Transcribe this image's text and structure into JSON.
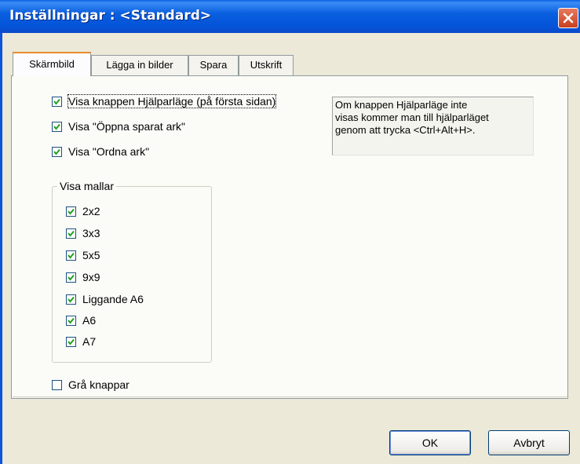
{
  "window": {
    "title": "Inställningar : <Standard>"
  },
  "tabs": [
    {
      "label": "Skärmbild",
      "active": true
    },
    {
      "label": "Lägga in bilder",
      "active": false
    },
    {
      "label": "Spara",
      "active": false
    },
    {
      "label": "Utskrift",
      "active": false
    }
  ],
  "options": {
    "show_help_mode": {
      "label": "Visa knappen Hjälparläge (på första sidan)",
      "checked": true
    },
    "show_open_saved": {
      "label": "Visa \"Öppna sparat ark\"",
      "checked": true
    },
    "show_arrange": {
      "label": "Visa \"Ordna ark\"",
      "checked": true
    },
    "gray_buttons": {
      "label": "Grå knappar",
      "checked": false
    }
  },
  "templates_group": {
    "legend": "Visa mallar",
    "items": [
      {
        "label": "2x2",
        "checked": true
      },
      {
        "label": "3x3",
        "checked": true
      },
      {
        "label": "5x5",
        "checked": true
      },
      {
        "label": "9x9",
        "checked": true
      },
      {
        "label": "Liggande A6",
        "checked": true
      },
      {
        "label": "A6",
        "checked": true
      },
      {
        "label": "A7",
        "checked": true
      }
    ]
  },
  "info_box": {
    "line1": "Om knappen Hjälparläge inte",
    "line2": "visas kommer man till hjälparläget",
    "line3": "genom att trycka <Ctrl+Alt+H>."
  },
  "buttons": {
    "ok": "OK",
    "cancel": "Avbryt"
  }
}
